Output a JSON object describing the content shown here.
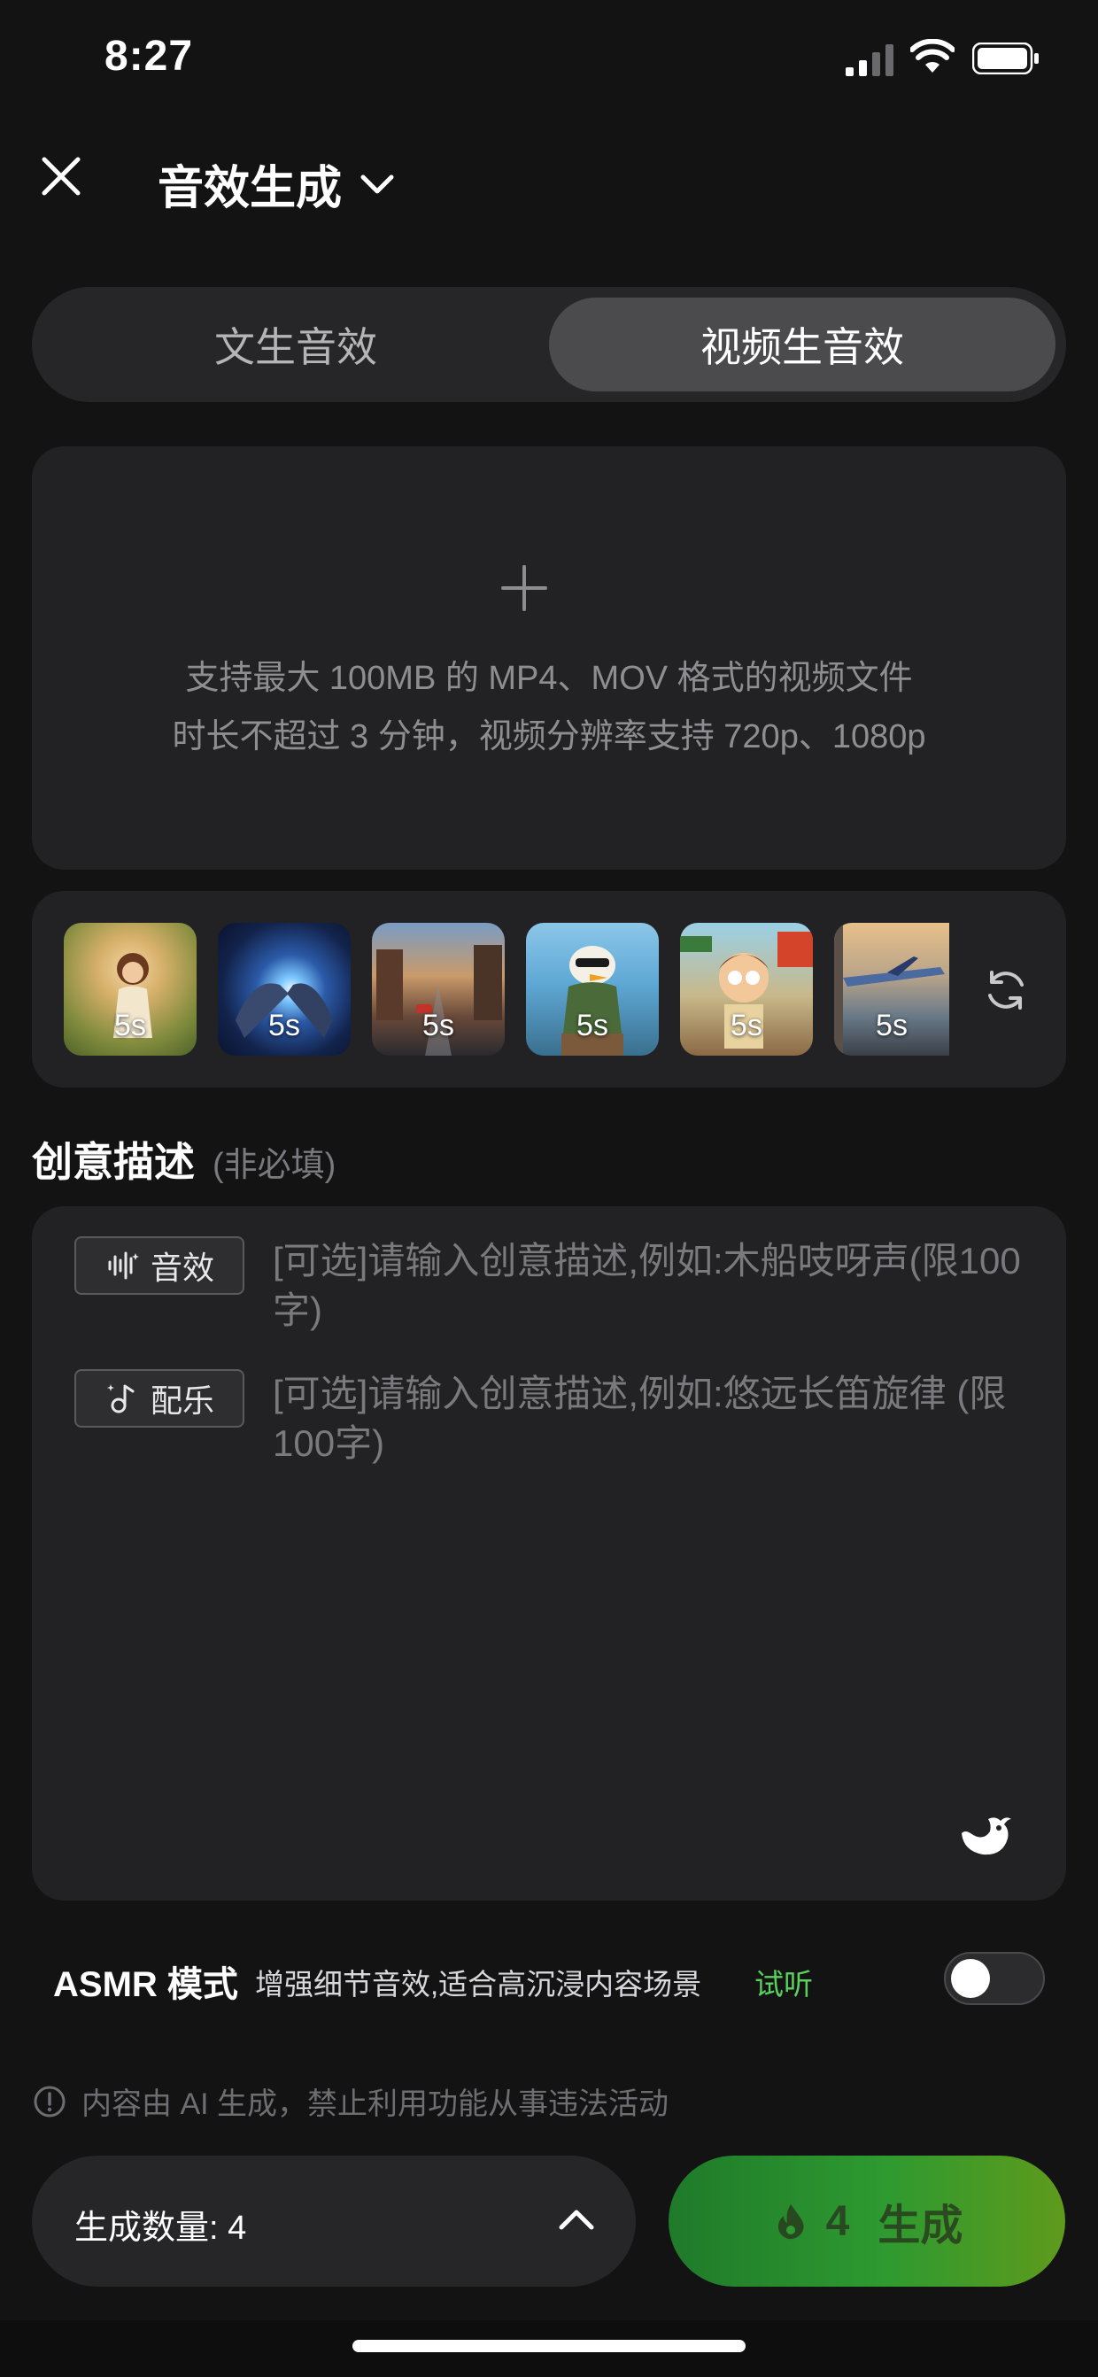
{
  "status_bar": {
    "time": "8:27"
  },
  "nav": {
    "title": "音效生成"
  },
  "tabs": [
    {
      "label": "文生音效",
      "active": false
    },
    {
      "label": "视频生音效",
      "active": true
    }
  ],
  "upload": {
    "line1": "支持最大 100MB 的 MP4、MOV 格式的视频文件",
    "line2": "时长不超过 3 分钟，视频分辨率支持 720p、1080p"
  },
  "samples": [
    {
      "duration": "5s"
    },
    {
      "duration": "5s"
    },
    {
      "duration": "5s"
    },
    {
      "duration": "5s"
    },
    {
      "duration": "5s"
    },
    {
      "duration": "5s"
    }
  ],
  "description": {
    "title": "创意描述",
    "hint": "(非必填)",
    "sfx_chip": "音效",
    "sfx_placeholder": "[可选]请输入创意描述,例如:木船吱呀声(限100字)",
    "music_chip": "配乐",
    "music_placeholder": "[可选]请输入创意描述,例如:悠远长笛旋律 (限100字)"
  },
  "asmr": {
    "title": "ASMR 模式",
    "desc": "增强细节音效,适合高沉浸内容场景",
    "try_label": "试听",
    "enabled": false
  },
  "notice": "内容由 AI 生成，禁止利用功能从事违法活动",
  "footer": {
    "quantity_label": "生成数量: 4",
    "cost": "4",
    "generate_label": "生成"
  },
  "colors": {
    "background": "#131314",
    "card": "#222224",
    "accent_green": "#59d15c"
  },
  "icons": [
    "close-icon",
    "chevron-down-icon",
    "plus-icon",
    "refresh-icon",
    "sound-wave-icon",
    "music-note-icon",
    "whale-icon",
    "info-icon",
    "chevron-up-icon",
    "flame-icon"
  ]
}
